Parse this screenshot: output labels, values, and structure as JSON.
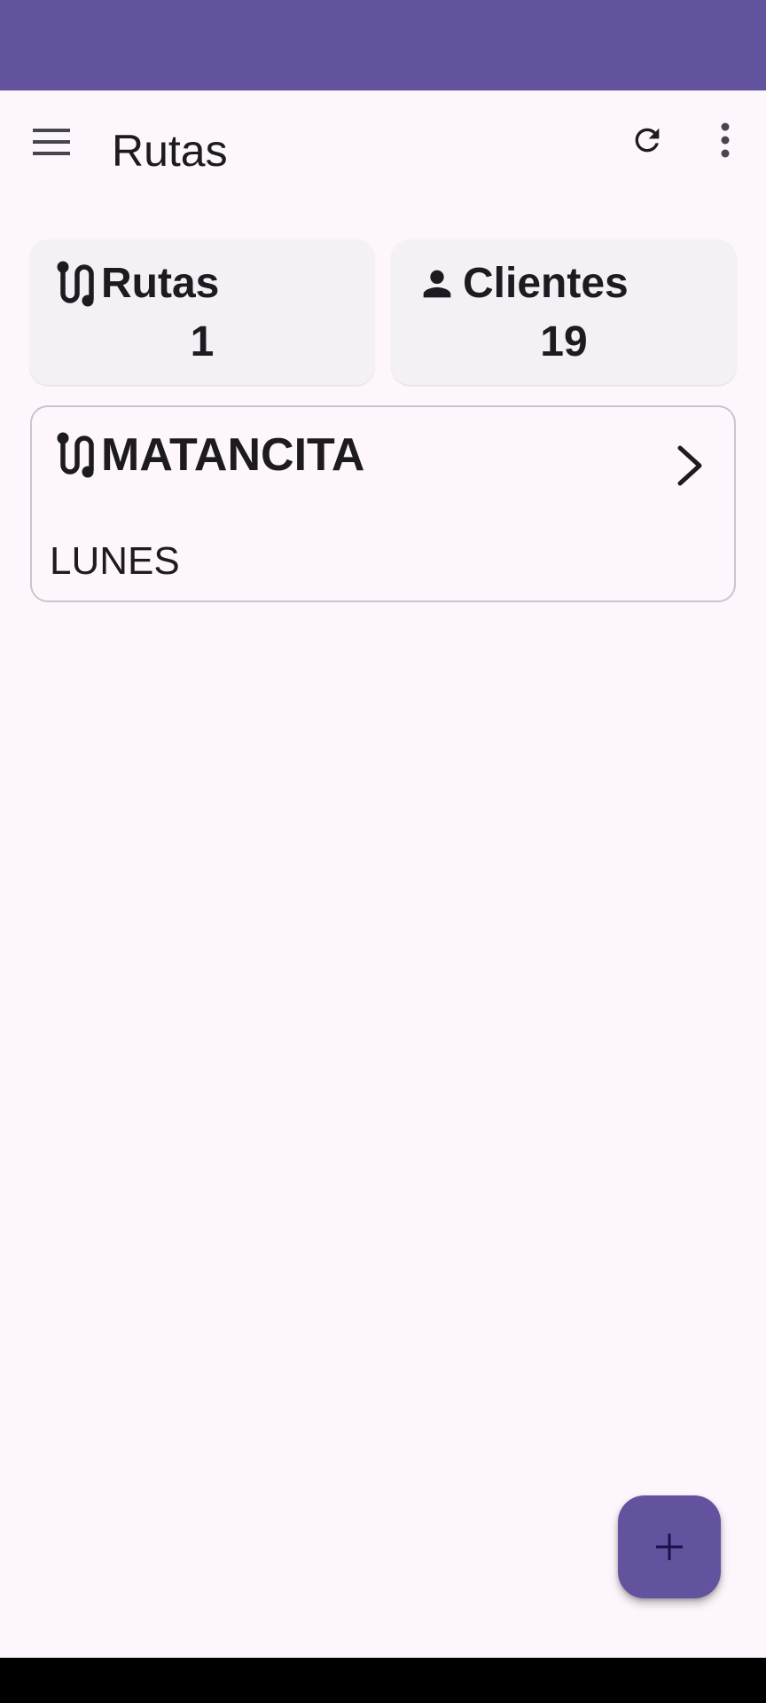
{
  "colors": {
    "status_bar": "#63529e",
    "background": "#fdf7fd",
    "card_bg": "#f3f1f6",
    "fab": "#63529e",
    "text": "#1d1b20",
    "nav_bar": "#000000"
  },
  "app_bar": {
    "title": "Rutas",
    "icons": [
      "menu-icon",
      "refresh-icon",
      "more-vert-icon"
    ]
  },
  "stats": {
    "rutas": {
      "icon": "route-icon",
      "label": "Rutas",
      "value": "1"
    },
    "clientes": {
      "icon": "person-icon",
      "label": "Clientes",
      "value": "19"
    }
  },
  "routes": [
    {
      "icon": "route-icon",
      "name": "MATANCITA",
      "day": "LUNES",
      "action_icon": "chevron-right-icon"
    }
  ],
  "fab": {
    "icon": "add-icon"
  }
}
